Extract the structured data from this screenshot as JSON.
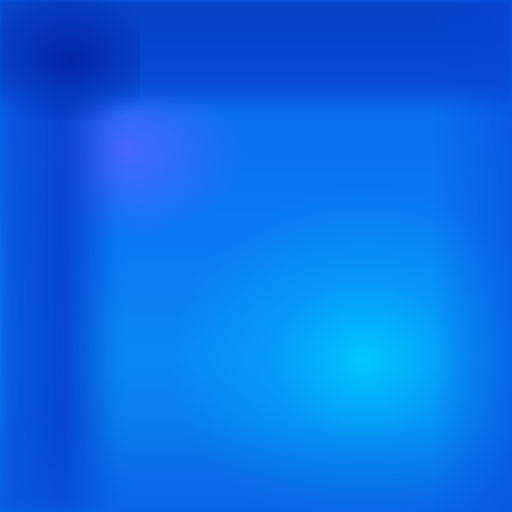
{
  "wallpaper": {
    "style": "blurred-blue-gradient",
    "colors": {
      "top_band": "#0640c6",
      "base": "#0a6fe8",
      "glow_cyan": "#00d2ff",
      "accent_violet": "#5a64ff"
    }
  }
}
